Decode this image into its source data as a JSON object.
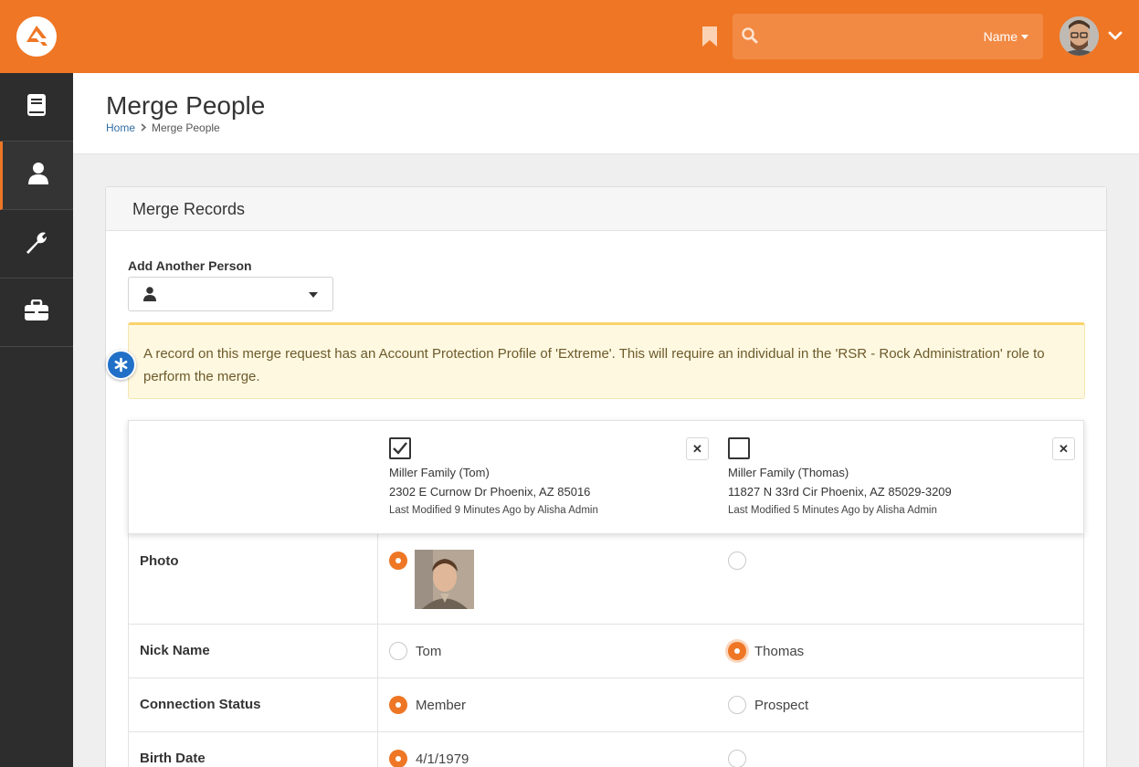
{
  "search": {
    "filter_label": "Name"
  },
  "page": {
    "title": "Merge People"
  },
  "breadcrumb": {
    "home": "Home",
    "current": "Merge People"
  },
  "panel": {
    "title": "Merge Records"
  },
  "add_person": {
    "label": "Add Another Person"
  },
  "alert": {
    "text": "A record on this merge request has an Account Protection Profile of 'Extreme'. This will require an individual in the 'RSR - Rock Administration' role to perform the merge."
  },
  "records": [
    {
      "family": "Miller Family (Tom)",
      "address": "2302 E Curnow Dr Phoenix, AZ 85016",
      "modified": "Last Modified 9 Minutes Ago by Alisha Admin",
      "checked": true
    },
    {
      "family": "Miller Family (Thomas)",
      "address": "11827 N 33rd Cir Phoenix, AZ 85029-3209",
      "modified": "Last Modified 5 Minutes Ago by Alisha Admin",
      "checked": false
    }
  ],
  "rows": [
    {
      "label": "Photo",
      "left": {
        "value": "",
        "selected": true
      },
      "right": {
        "value": "",
        "selected": false
      }
    },
    {
      "label": "Nick Name",
      "left": {
        "value": "Tom",
        "selected": false
      },
      "right": {
        "value": "Thomas",
        "selected": true
      }
    },
    {
      "label": "Connection Status",
      "left": {
        "value": "Member",
        "selected": true
      },
      "right": {
        "value": "Prospect",
        "selected": false
      }
    },
    {
      "label": "Birth Date",
      "left": {
        "value": "4/1/1979",
        "selected": true
      },
      "right": {
        "value": "",
        "selected": false
      }
    }
  ],
  "colors": {
    "brand": "#ee7625",
    "sidebar": "#2d2d2d",
    "alert_bg": "#fff8e1",
    "info_badge": "#2170c7"
  },
  "icons": {
    "logo": "rock-logo-icon",
    "bookmark": "bookmark-icon",
    "search": "search-icon",
    "chevron": "chevron-down-icon",
    "sidebar": [
      "book-icon",
      "user-icon",
      "wrench-icon",
      "briefcase-icon"
    ],
    "badge": "asterisk-icon"
  }
}
